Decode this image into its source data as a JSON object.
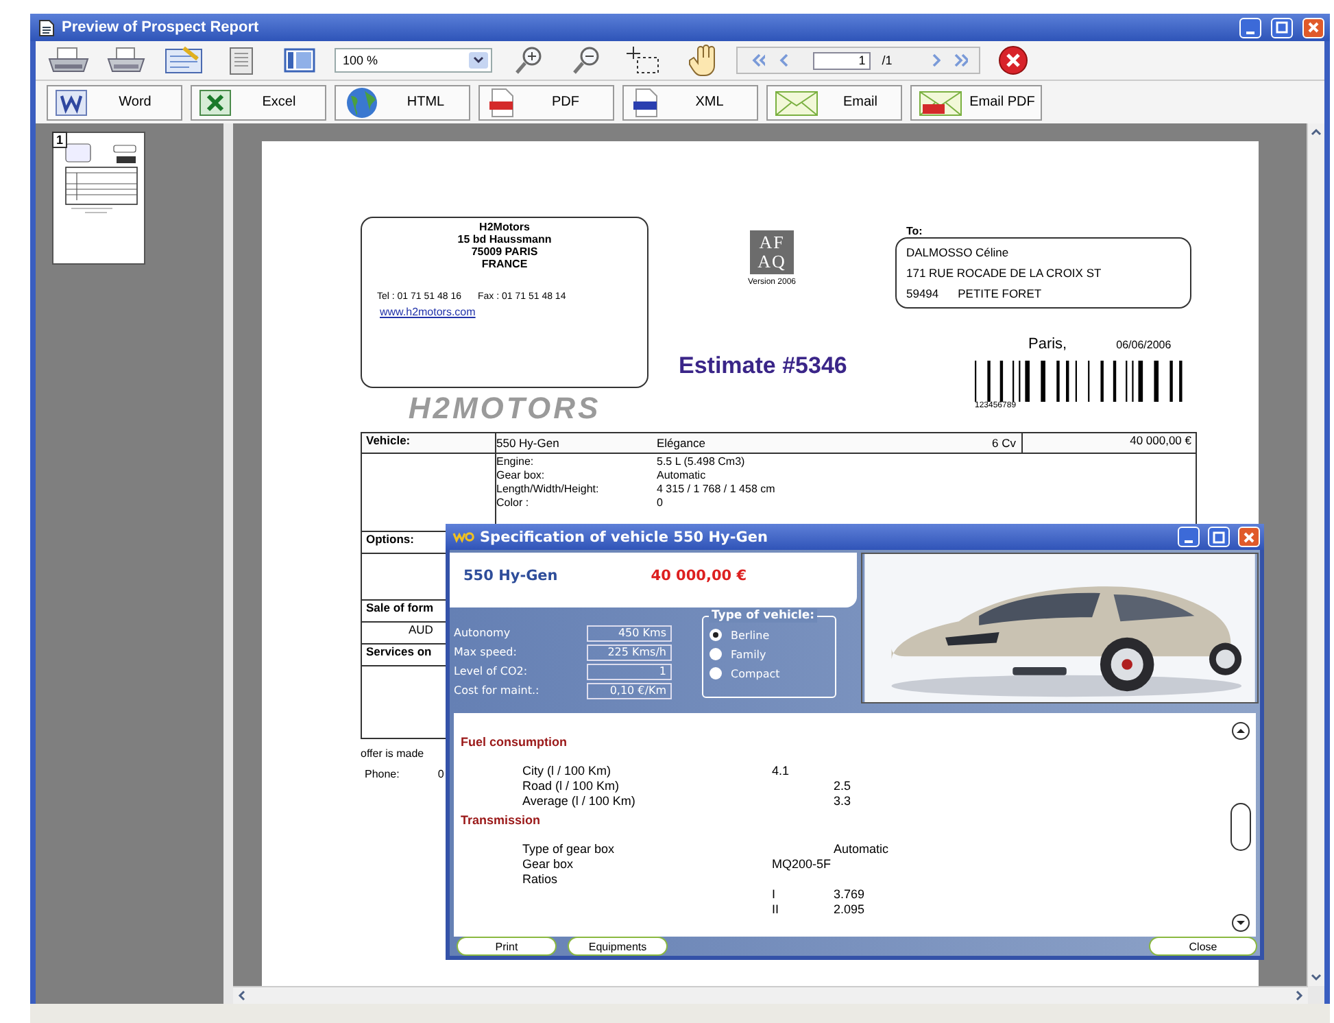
{
  "window": {
    "title": "Preview of Prospect Report"
  },
  "toolbar": {
    "zoom": "100 %",
    "page": "1",
    "page_count": "/1"
  },
  "export_buttons": [
    {
      "kind": "word",
      "label": "Word"
    },
    {
      "kind": "excel",
      "label": "Excel"
    },
    {
      "kind": "html",
      "label": "HTML"
    },
    {
      "kind": "pdf",
      "label": "PDF"
    },
    {
      "kind": "xml",
      "label": "XML"
    },
    {
      "kind": "email",
      "label": "Email"
    },
    {
      "kind": "email_pdf",
      "label": "Email PDF"
    }
  ],
  "thumbnails": [
    {
      "number": "1"
    }
  ],
  "document": {
    "company": {
      "lines": [
        "H2Motors",
        "15 bd Haussmann",
        "75009 PARIS",
        "FRANCE"
      ],
      "tel": "Tel : 01 71 51 48 16",
      "fax": "Fax : 01 71 51 48 14",
      "website": "www.h2motors.com",
      "brand": "H2MOTORS"
    },
    "certification": {
      "logo_top": "AF",
      "logo_bottom": "AQ",
      "version": "Version 2006"
    },
    "recipient": {
      "label": "To:",
      "name": "DALMOSSO Céline",
      "street": "171 RUE ROCADE DE LA CROIX ST",
      "zip": "59494",
      "city": "PETITE FORET"
    },
    "place": "Paris,",
    "date": "06/06/2006",
    "title": "Estimate #5346",
    "barcode_number": "123456789",
    "vehicle": {
      "label": "Vehicle:",
      "model": "550 Hy-Gen",
      "trim": "Elégance",
      "power": "6 Cv",
      "price": "40 000,00 €"
    },
    "specs": [
      {
        "label": "Engine:",
        "value": "5.5 L (5.498 Cm3)"
      },
      {
        "label": "Gear box:",
        "value": "Automatic"
      },
      {
        "label": "Length/Width/Height:",
        "value": "4 315 / 1 768 / 1 458 cm"
      },
      {
        "label": "Color :",
        "value": "0"
      }
    ],
    "rows": [
      {
        "kind": "heading",
        "label": "Options:"
      },
      {
        "kind": "blank"
      },
      {
        "kind": "heading",
        "label": "Sale of form"
      },
      {
        "kind": "value",
        "label": "AUD"
      },
      {
        "kind": "heading",
        "label": "Services on"
      },
      {
        "kind": "blank"
      }
    ],
    "footer": {
      "offer": "offer is made",
      "phone_label": "Phone:",
      "phone": "0"
    }
  },
  "dialog": {
    "title": "Specification of vehicle 550 Hy-Gen",
    "model": "550 Hy-Gen",
    "price": "40 000,00 €",
    "fields": [
      {
        "label": "Autonomy",
        "value": "450 Kms"
      },
      {
        "label": "Max speed:",
        "value": "225 Kms/h"
      },
      {
        "label": "Level of CO2:",
        "value": "1"
      },
      {
        "label": "Cost for maint.:",
        "value": "0,10 €/Km"
      }
    ],
    "vehicle_type_label": "Type of vehicle:",
    "vehicle_types": [
      {
        "label": "Berline",
        "selected": true
      },
      {
        "label": "Family",
        "selected": false
      },
      {
        "label": "Compact",
        "selected": false
      }
    ],
    "sections": [
      {
        "title": "Fuel consumption",
        "rows": [
          {
            "label": "City (l / 100 Km)",
            "col1": "4.1",
            "col2": ""
          },
          {
            "label": "Road (l / 100 Km)",
            "col1": "",
            "col2": "2.5"
          },
          {
            "label": "Average (l / 100 Km)",
            "col1": "",
            "col2": "3.3"
          }
        ]
      },
      {
        "title": "Transmission",
        "rows": [
          {
            "label": "Type of gear box",
            "col1": "",
            "col2": "Automatic"
          },
          {
            "label": "Gear box",
            "col1": "MQ200-5F",
            "col2": ""
          },
          {
            "label": "Ratios",
            "col1": "",
            "col2": ""
          },
          {
            "label": "",
            "col1": "I",
            "col2": "3.769"
          },
          {
            "label": "",
            "col1": "II",
            "col2": "2.095"
          }
        ]
      }
    ],
    "buttons": [
      {
        "label": "Print",
        "kind": "left"
      },
      {
        "label": "Equipments",
        "kind": "left"
      },
      {
        "label": "Close",
        "kind": "right"
      }
    ]
  }
}
